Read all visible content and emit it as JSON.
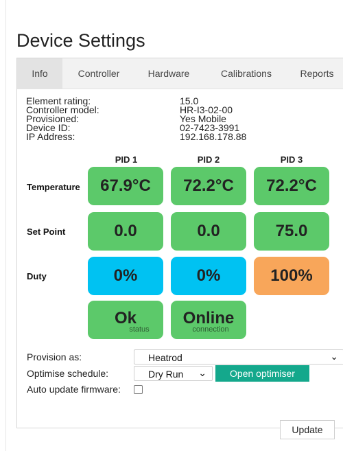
{
  "page": {
    "title": "Device Settings"
  },
  "tabs": [
    {
      "label": "Info",
      "active": true
    },
    {
      "label": "Controller",
      "active": false
    },
    {
      "label": "Hardware",
      "active": false
    },
    {
      "label": "Calibrations",
      "active": false
    },
    {
      "label": "Reports",
      "active": false
    }
  ],
  "info": {
    "element_rating": {
      "label": "Element rating:",
      "value": "15.0"
    },
    "controller_model": {
      "label": "Controller model:",
      "value": "HR-I3-02-00"
    },
    "provisioned": {
      "label": "Provisioned:",
      "value": "Yes Mobile"
    },
    "device_id": {
      "label": "Device ID:",
      "value": "02-7423-3991"
    },
    "ip_address": {
      "label": "IP Address:",
      "value": "192.168.178.88"
    }
  },
  "pids": [
    "PID 1",
    "PID 2",
    "PID 3"
  ],
  "rows": {
    "temperature": {
      "label": "Temperature",
      "values": [
        "67.9°C",
        "72.2°C",
        "72.2°C"
      ]
    },
    "set_point": {
      "label": "Set Point",
      "values": [
        "0.0",
        "0.0",
        "75.0"
      ]
    },
    "duty": {
      "label": "Duty",
      "values": [
        "0%",
        "0%",
        "100%"
      ],
      "percent": [
        0,
        0,
        100
      ]
    }
  },
  "status": {
    "status": {
      "value": "Ok",
      "caption": "status"
    },
    "connection": {
      "value": "Online",
      "caption": "connection"
    }
  },
  "colors": {
    "ok": "#5cc96a",
    "idle": "#00c2f2",
    "active": "#f8a65a",
    "accent": "#14a88c"
  },
  "form": {
    "provision_as": {
      "label": "Provision as:",
      "value": "Heatrod"
    },
    "optimise_schedule": {
      "label": "Optimise schedule:",
      "value": "Dry Run",
      "button": "Open optimiser"
    },
    "auto_update": {
      "label": "Auto update firmware:",
      "checked": false
    },
    "update_button": "Update"
  }
}
